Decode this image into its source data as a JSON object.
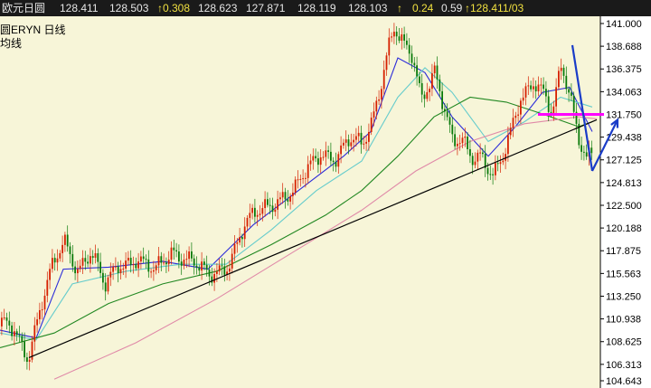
{
  "quote_bar": {
    "symbol": "欧元日圆",
    "open": "128.411",
    "high": "128.503",
    "change": "↑0.308",
    "value4": "128.623",
    "value5": "127.871",
    "value6": "128.119",
    "value7": "128.103",
    "arrow": "↑",
    "pct_change": "0.24",
    "value10": "0.59",
    "last": "↑128.411/03"
  },
  "labels": {
    "symbol_period": "圆ERYN   日线",
    "indicator": "均线"
  },
  "colors": {
    "background": "#f7f5d8",
    "up_candle": "#d62000",
    "down_candle": "#0a7a0a",
    "ma_fast": "#2b2bd9",
    "ma_mid": "#66cccc",
    "ma_slow": "#228822",
    "ma_long": "#e08aa8",
    "trendline": "#000000",
    "arrow": "#1a3cc8",
    "support": "#ff00ff"
  },
  "chart_data": {
    "type": "candlestick",
    "y_axis_side": "right",
    "y_ticks": [
      141.0,
      138.688,
      136.375,
      134.063,
      131.75,
      129.438,
      127.125,
      124.813,
      122.5,
      120.188,
      117.875,
      115.563,
      113.25,
      110.938,
      108.625,
      106.313,
      104.643
    ],
    "y_tick_labels": [
      "141.000",
      "138.688",
      "136.375",
      "134.063",
      "131.750",
      "129.438",
      "127.125",
      "124.813",
      "122.500",
      "120.188",
      "117.875",
      "115.563",
      "113.250",
      "110.938",
      "108.625",
      "106.313",
      "104.643"
    ],
    "ylim": [
      104.643,
      141.0
    ],
    "price_path": [
      [
        0,
        110.2
      ],
      [
        15,
        109.8
      ],
      [
        30,
        107.2
      ],
      [
        40,
        110.8
      ],
      [
        55,
        115.5
      ],
      [
        70,
        118.8
      ],
      [
        85,
        116.2
      ],
      [
        100,
        117.8
      ],
      [
        115,
        114.0
      ],
      [
        130,
        116.5
      ],
      [
        150,
        117.2
      ],
      [
        170,
        115.5
      ],
      [
        190,
        118.0
      ],
      [
        210,
        117.0
      ],
      [
        230,
        115.0
      ],
      [
        250,
        116.5
      ],
      [
        270,
        120.5
      ],
      [
        290,
        122.0
      ],
      [
        310,
        123.5
      ],
      [
        325,
        124.0
      ],
      [
        340,
        126.0
      ],
      [
        355,
        128.0
      ],
      [
        370,
        127.5
      ],
      [
        385,
        129.0
      ],
      [
        400,
        128.5
      ],
      [
        410,
        131.0
      ],
      [
        420,
        135.0
      ],
      [
        428,
        138.5
      ],
      [
        435,
        140.5
      ],
      [
        445,
        138.5
      ],
      [
        455,
        137.5
      ],
      [
        465,
        133.5
      ],
      [
        480,
        136.5
      ],
      [
        490,
        132.5
      ],
      [
        500,
        128.5
      ],
      [
        510,
        129.0
      ],
      [
        520,
        127.5
      ],
      [
        530,
        128.0
      ],
      [
        545,
        125.5
      ],
      [
        555,
        127.0
      ],
      [
        565,
        130.0
      ],
      [
        575,
        133.5
      ],
      [
        590,
        135.5
      ],
      [
        600,
        134.0
      ],
      [
        610,
        131.5
      ],
      [
        620,
        136.5
      ],
      [
        630,
        133.5
      ],
      [
        640,
        129.5
      ],
      [
        648,
        127.5
      ],
      [
        655,
        128.2
      ]
    ],
    "moving_averages": [
      {
        "color_key": "ma_fast",
        "path": [
          [
            0,
            109.8
          ],
          [
            40,
            109.0
          ],
          [
            70,
            116.0
          ],
          [
            120,
            116.2
          ],
          [
            180,
            116.8
          ],
          [
            230,
            116.0
          ],
          [
            280,
            120.5
          ],
          [
            330,
            124.0
          ],
          [
            380,
            127.5
          ],
          [
            410,
            130.0
          ],
          [
            440,
            137.5
          ],
          [
            470,
            136.0
          ],
          [
            500,
            131.5
          ],
          [
            540,
            127.5
          ],
          [
            570,
            130.5
          ],
          [
            600,
            134.0
          ],
          [
            630,
            134.5
          ],
          [
            655,
            130.0
          ]
        ]
      },
      {
        "color_key": "ma_mid",
        "path": [
          [
            0,
            109.5
          ],
          [
            40,
            108.8
          ],
          [
            80,
            114.5
          ],
          [
            140,
            115.8
          ],
          [
            200,
            116.5
          ],
          [
            250,
            116.5
          ],
          [
            300,
            120.0
          ],
          [
            350,
            124.0
          ],
          [
            400,
            127.0
          ],
          [
            440,
            133.5
          ],
          [
            470,
            136.5
          ],
          [
            500,
            134.0
          ],
          [
            540,
            129.0
          ],
          [
            580,
            131.0
          ],
          [
            620,
            133.5
          ],
          [
            655,
            132.5
          ]
        ]
      },
      {
        "color_key": "ma_slow",
        "path": [
          [
            0,
            108.0
          ],
          [
            60,
            109.5
          ],
          [
            120,
            112.5
          ],
          [
            180,
            114.5
          ],
          [
            240,
            115.8
          ],
          [
            300,
            118.5
          ],
          [
            360,
            121.5
          ],
          [
            400,
            124.0
          ],
          [
            440,
            127.5
          ],
          [
            480,
            131.5
          ],
          [
            520,
            133.5
          ],
          [
            560,
            133.0
          ],
          [
            600,
            131.8
          ],
          [
            640,
            130.5
          ],
          [
            655,
            131.0
          ]
        ]
      },
      {
        "color_key": "ma_long",
        "path": [
          [
            60,
            104.8
          ],
          [
            150,
            108.5
          ],
          [
            240,
            113.0
          ],
          [
            320,
            117.5
          ],
          [
            400,
            122.0
          ],
          [
            460,
            126.0
          ],
          [
            520,
            129.0
          ],
          [
            580,
            130.8
          ],
          [
            640,
            131.5
          ],
          [
            660,
            131.3
          ]
        ]
      }
    ],
    "trendline": [
      [
        32,
        107.0
      ],
      [
        660,
        131.2
      ]
    ],
    "support_line": [
      [
        595,
        131.75
      ],
      [
        668,
        131.75
      ]
    ],
    "arrows": [
      {
        "from": [
          633,
          138.8
        ],
        "to": [
          655,
          126.0
        ]
      },
      {
        "from": [
          655,
          126.0
        ],
        "to": [
          683,
          131.2
        ]
      }
    ]
  }
}
